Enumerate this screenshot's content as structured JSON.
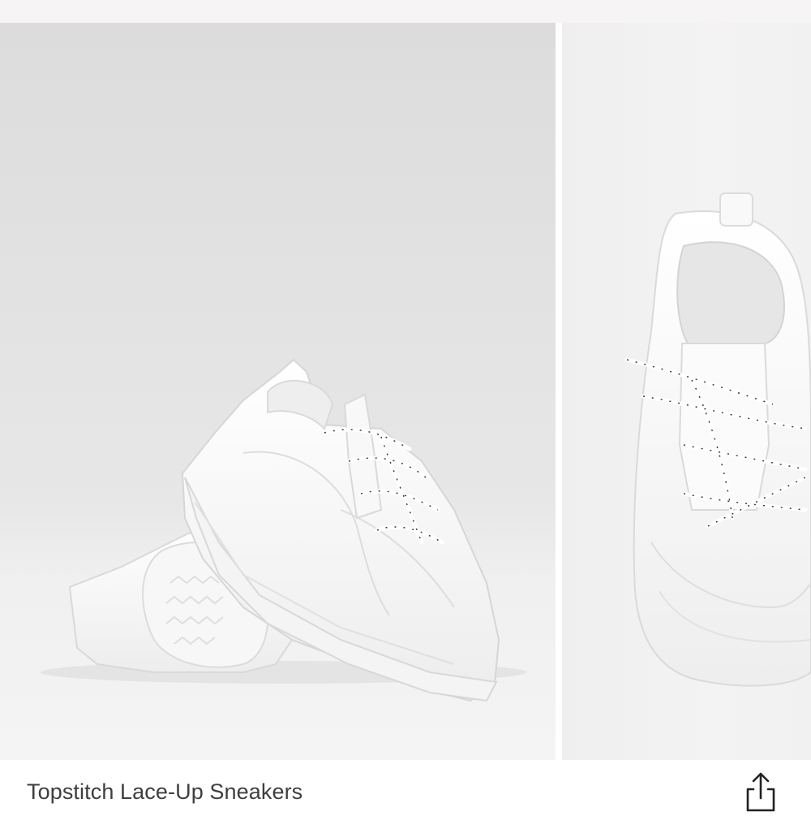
{
  "product": {
    "title": "Topstitch Lace-Up Sneakers"
  },
  "gallery": {
    "images": [
      {
        "description": "white-chunky-sneakers-side-and-sole"
      },
      {
        "description": "white-chunky-sneaker-top-view"
      }
    ]
  },
  "icons": {
    "share": "share-icon"
  },
  "colors": {
    "title_text": "#3e3e3e",
    "top_bar": "#f6f4f4",
    "photo_backdrop": "#dcdcdc"
  }
}
